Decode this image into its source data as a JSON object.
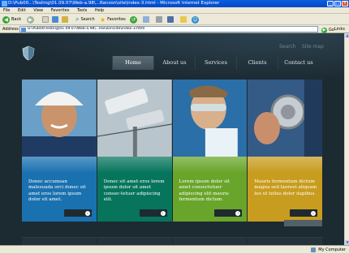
{
  "window": {
    "title": "D:\\Pub00...\\Testing\\01.09.07\\Web-a.98\\...Ranzon\\site\\index-3.html - Microsoft Internet Explorer"
  },
  "menu": [
    "File",
    "Edit",
    "View",
    "Favorites",
    "Tools",
    "Help"
  ],
  "toolbar": {
    "back_label": "Back",
    "search_label": "Search",
    "favorites_label": "Favorites"
  },
  "address": {
    "label": "Address",
    "value": "D:\\Pub00\\Testing\\01.09.07\\Web-a.98\\...Ranzon\\site\\index-3.html",
    "go_label": "Go",
    "links_label": "Links"
  },
  "status": {
    "text": "",
    "zone": "My Computer"
  },
  "site": {
    "toplinks": [
      "Search",
      "Site map"
    ],
    "nav": [
      "Home",
      "About us",
      "Services",
      "Clients",
      "Contact us"
    ],
    "active_nav": "Home",
    "columns": [
      {
        "text": "Donec accumsan malesuada orci donec sit amet eros lorem ipsum dolor sit amet.",
        "color": "#1a71b0"
      },
      {
        "text": "Donec sit amet eros lorem ipsum dolor sit amet consec-tetuer adipiscing elit.",
        "color": "#06755c"
      },
      {
        "text": "Lorem ipsum dolor sit amet consectetuer adipiscing elit mauris fermentum dictum.",
        "color": "#69a52a"
      },
      {
        "text": "Mauris fermentum dictum magna sed laoreet aliquam leo ut tellus dolor dapibus.",
        "color": "#c89c1e"
      }
    ]
  },
  "icons": {
    "logo": "shield-logo-icon",
    "more": "arrow-right-icon"
  }
}
